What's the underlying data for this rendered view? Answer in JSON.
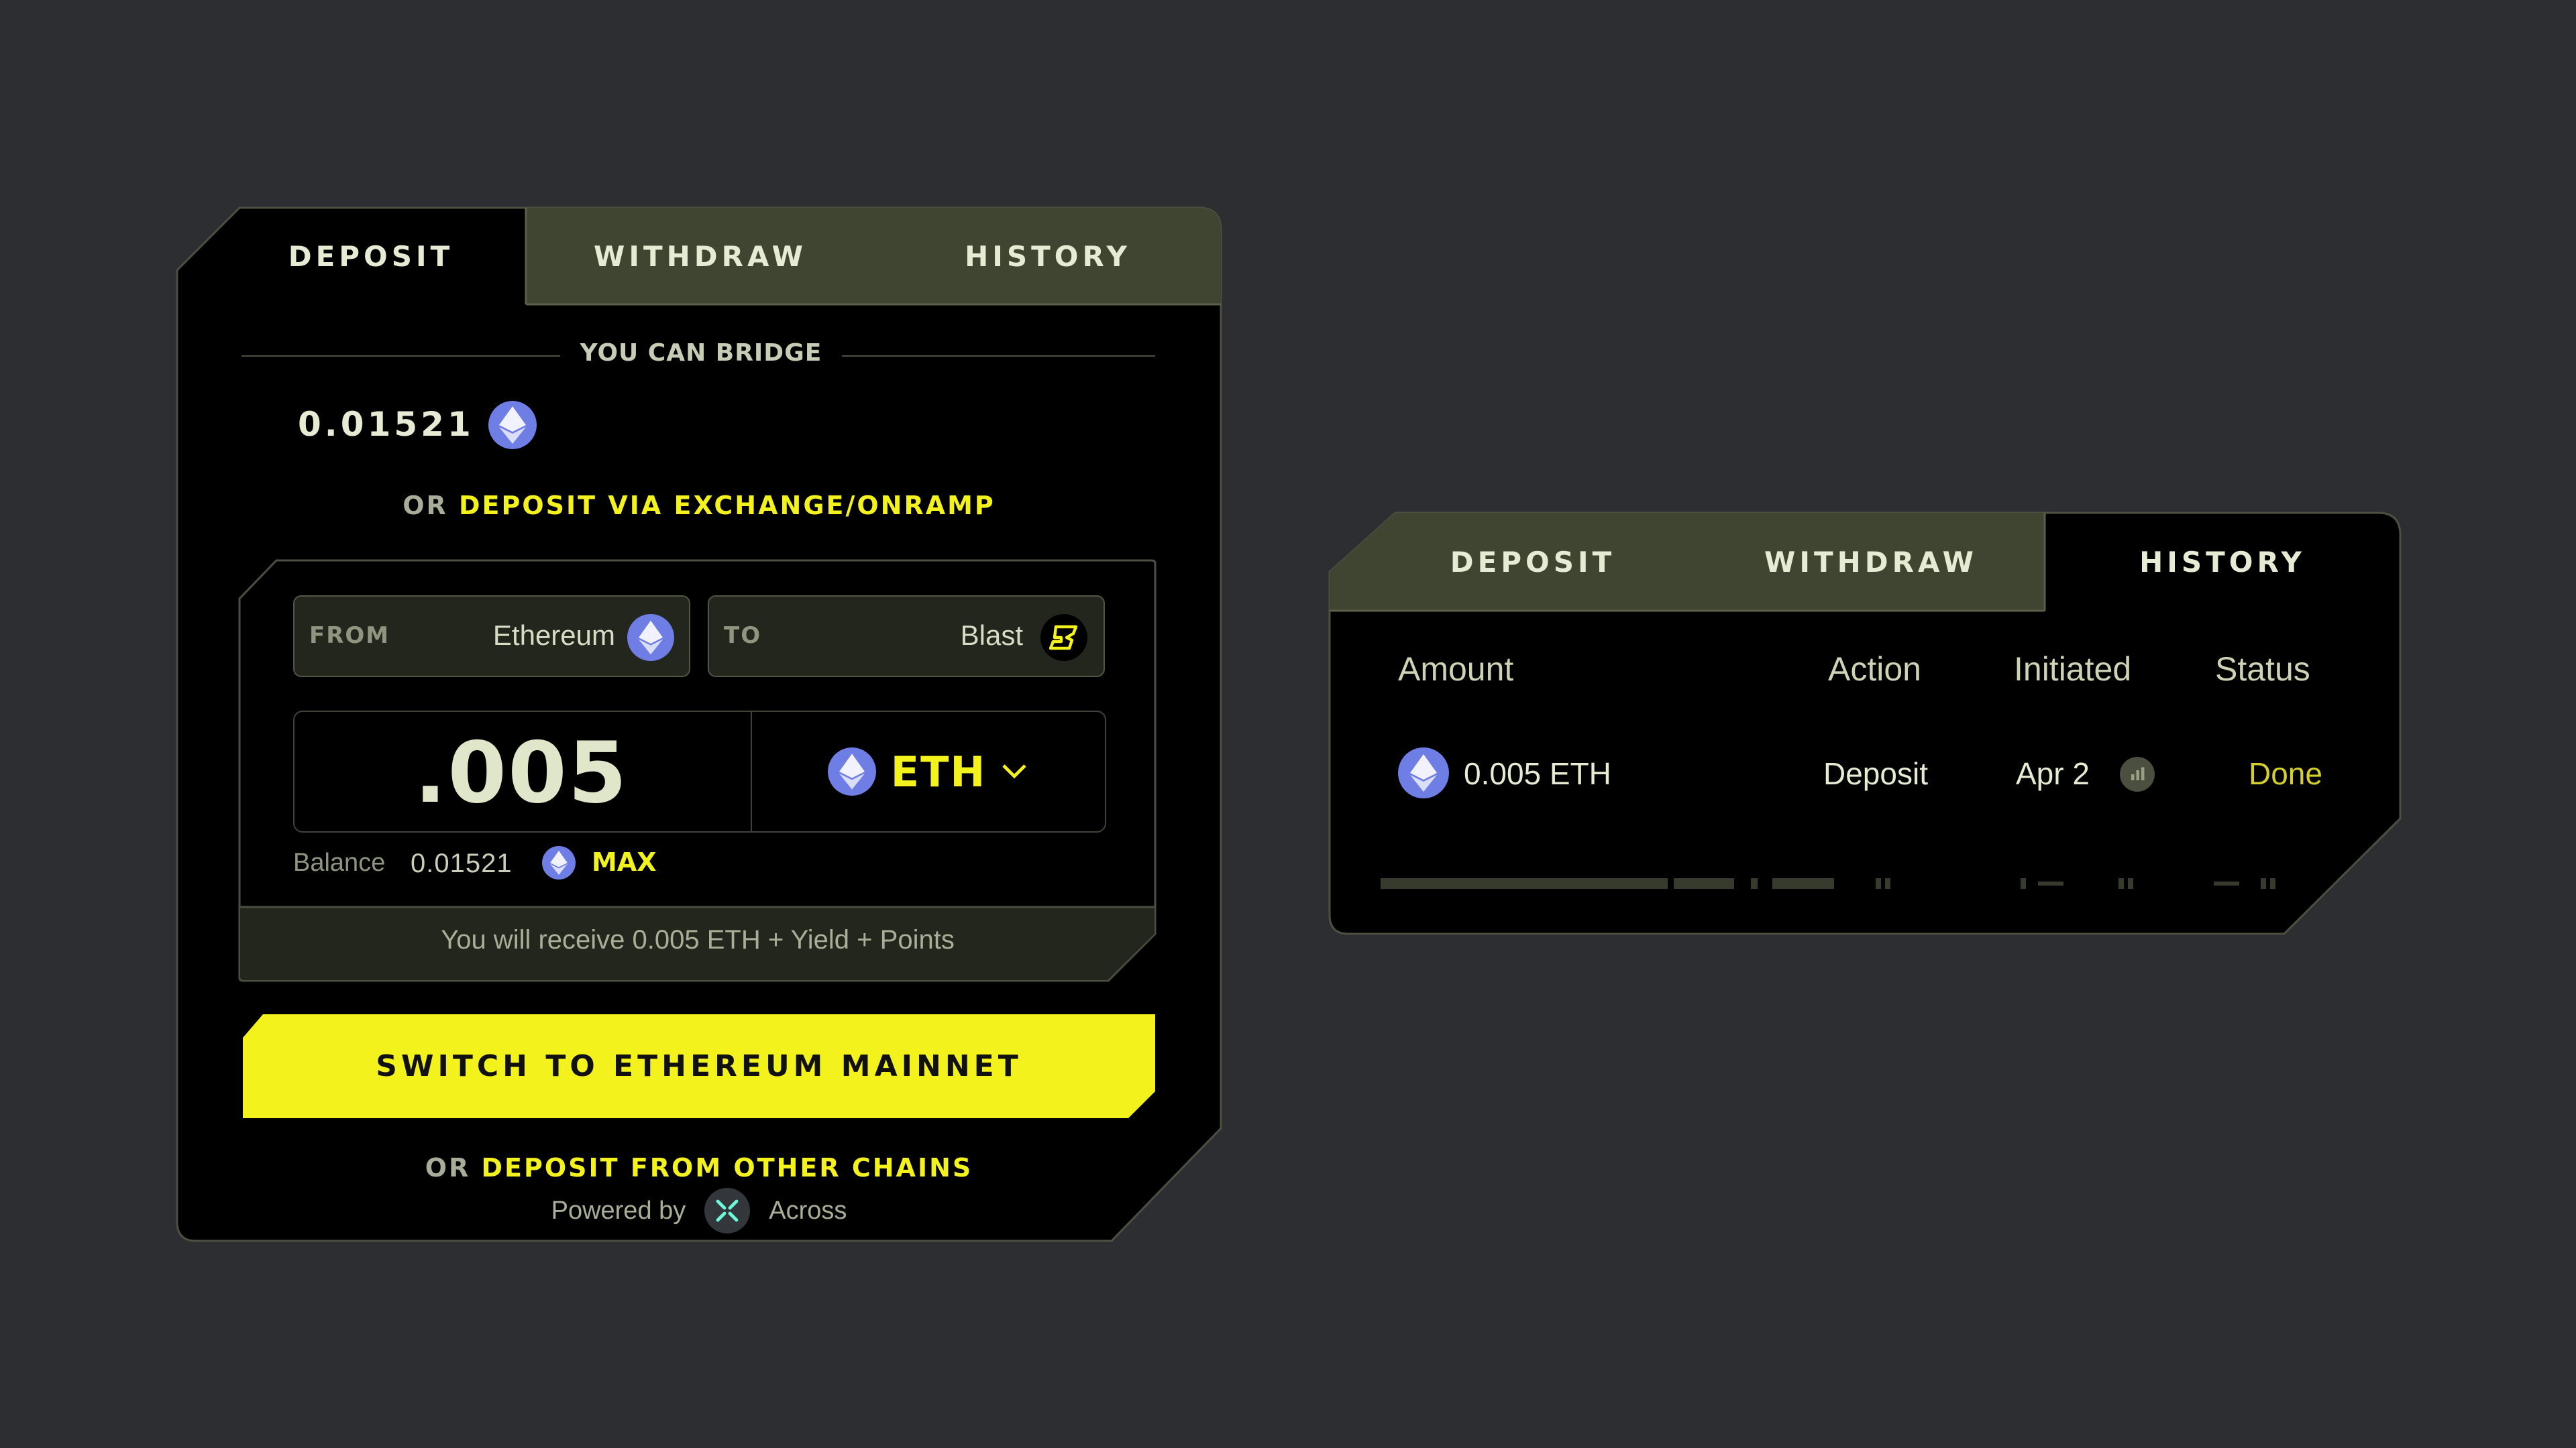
{
  "deposit_panel": {
    "tabs": [
      {
        "label": "DEPOSIT",
        "active": true
      },
      {
        "label": "WITHDRAW",
        "active": false
      },
      {
        "label": "HISTORY",
        "active": false
      }
    ],
    "bridge_heading": "YOU CAN BRIDGE",
    "bridge_amount": "0.01521",
    "exchange_prefix": "OR",
    "exchange_link": "DEPOSIT VIA EXCHANGE/ONRAMP",
    "from": {
      "label": "FROM",
      "chain": "Ethereum"
    },
    "to": {
      "label": "TO",
      "chain": "Blast"
    },
    "amount_input": ".005",
    "token": "ETH",
    "balance_label": "Balance",
    "balance_value": "0.01521",
    "max_label": "MAX",
    "receive_text": "You will receive 0.005 ETH + Yield + Points",
    "switch_button": "SWITCH TO ETHEREUM MAINNET",
    "other_chains_prefix": "OR",
    "other_chains_link": "DEPOSIT FROM OTHER CHAINS",
    "powered_by": "Powered by",
    "provider": "Across"
  },
  "history_panel": {
    "tabs": [
      {
        "label": "DEPOSIT",
        "active": false
      },
      {
        "label": "WITHDRAW",
        "active": false
      },
      {
        "label": "HISTORY",
        "active": true
      }
    ],
    "columns": [
      "Amount",
      "Action",
      "Initiated",
      "Status"
    ],
    "rows": [
      {
        "amount": "0.005 ETH",
        "action": "Deposit",
        "initiated": "Apr 2",
        "status": "Done"
      }
    ]
  },
  "colors": {
    "background": "#2d2e32",
    "panel": "#000000",
    "tab_inactive": "#3f4531",
    "accent": "#f4f21c",
    "eth": "#6e7ee4"
  },
  "icons": [
    "eth-icon",
    "blast-icon",
    "chevron-down-icon",
    "across-icon",
    "pending-clock-icon"
  ]
}
